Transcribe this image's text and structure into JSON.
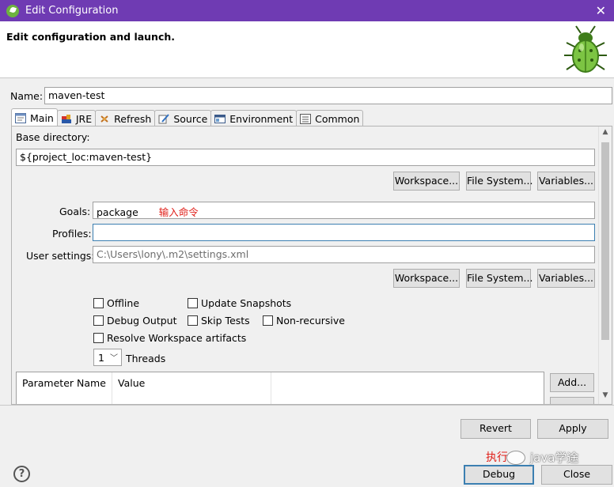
{
  "window": {
    "title": "Edit Configuration"
  },
  "header": {
    "subtitle": "Edit configuration and launch."
  },
  "name": {
    "label": "Name:",
    "value": "maven-test"
  },
  "tabs": [
    {
      "label": "Main",
      "icon": "main-tab-icon",
      "active": true
    },
    {
      "label": "JRE",
      "icon": "jre-icon"
    },
    {
      "label": "Refresh",
      "icon": "refresh-icon"
    },
    {
      "label": "Source",
      "icon": "source-icon"
    },
    {
      "label": "Environment",
      "icon": "environment-icon"
    },
    {
      "label": "Common",
      "icon": "common-icon"
    }
  ],
  "main": {
    "base_dir_label": "Base directory:",
    "base_dir_value": "${project_loc:maven-test}",
    "base_buttons": {
      "workspace": "Workspace...",
      "file_system": "File System...",
      "variables": "Variables..."
    },
    "goals_label": "Goals:",
    "goals_value": "package",
    "goals_annotation": "输入命令",
    "profiles_label": "Profiles:",
    "profiles_value": "",
    "user_settings_label": "User settings:",
    "user_settings_value": "C:\\Users\\lony\\.m2\\settings.xml",
    "settings_buttons": {
      "workspace": "Workspace...",
      "file_system": "File System...",
      "variables": "Variables..."
    },
    "checkboxes": {
      "offline": "Offline",
      "update_snapshots": "Update Snapshots",
      "debug_output": "Debug Output",
      "skip_tests": "Skip Tests",
      "non_recursive": "Non-recursive",
      "resolve_workspace": "Resolve Workspace artifacts"
    },
    "threads_value": "1",
    "threads_label": "Threads",
    "params_table": {
      "columns": [
        "Parameter Name",
        "Value"
      ]
    },
    "add_button": "Add..."
  },
  "footer": {
    "revert": "Revert",
    "apply": "Apply",
    "debug": "Debug",
    "close": "Close",
    "debug_annotation": "执行",
    "watermark": "java学途",
    "help": "?"
  },
  "colors": {
    "titlebar": "#6f3bb3",
    "annotation": "#e0201a",
    "focus": "#3c7fb1"
  }
}
